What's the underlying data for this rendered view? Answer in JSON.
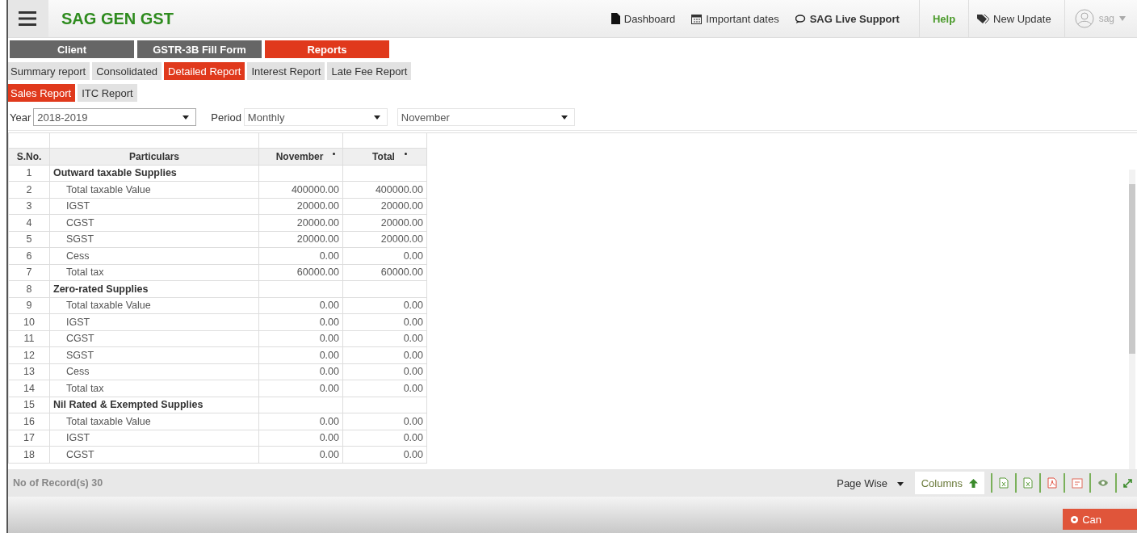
{
  "header": {
    "title": "SAG GEN GST",
    "links": [
      {
        "kind": "file",
        "label": "Dashboard"
      },
      {
        "kind": "calendar",
        "label": "Important dates"
      },
      {
        "kind": "chat",
        "label": "SAG Live Support"
      },
      {
        "kind": "help",
        "label": "Help"
      },
      {
        "kind": "tag",
        "label": "New Update"
      }
    ],
    "user": "sag"
  },
  "main_tabs": [
    {
      "label": "Client",
      "selected": false
    },
    {
      "label": "GSTR-3B Fill Form",
      "selected": false
    },
    {
      "label": "Reports",
      "selected": true
    }
  ],
  "report_tabs": [
    {
      "label": "Summary report",
      "selected": false
    },
    {
      "label": "Consolidated",
      "selected": false
    },
    {
      "label": "Detailed Report",
      "selected": true
    },
    {
      "label": "Interest Report",
      "selected": false
    },
    {
      "label": "Late Fee Report",
      "selected": false
    }
  ],
  "sub_tabs": [
    {
      "label": "Sales Report",
      "selected": true
    },
    {
      "label": "ITC Report",
      "selected": false
    }
  ],
  "filters": {
    "year_label": "Year",
    "year": "2018-2019",
    "period_label": "Period",
    "period": "Monthly",
    "month": "November"
  },
  "table": {
    "columns": [
      "S.No.",
      "Particulars",
      "November",
      "Total"
    ],
    "rows": [
      {
        "sno": "1",
        "particulars": "Outward taxable Supplies",
        "heading": true,
        "november": "",
        "total": ""
      },
      {
        "sno": "2",
        "particulars": "Total taxable Value",
        "heading": false,
        "november": "400000.00",
        "total": "400000.00"
      },
      {
        "sno": "3",
        "particulars": "IGST",
        "heading": false,
        "november": "20000.00",
        "total": "20000.00"
      },
      {
        "sno": "4",
        "particulars": "CGST",
        "heading": false,
        "november": "20000.00",
        "total": "20000.00"
      },
      {
        "sno": "5",
        "particulars": "SGST",
        "heading": false,
        "november": "20000.00",
        "total": "20000.00"
      },
      {
        "sno": "6",
        "particulars": "Cess",
        "heading": false,
        "november": "0.00",
        "total": "0.00"
      },
      {
        "sno": "7",
        "particulars": "Total tax",
        "heading": false,
        "november": "60000.00",
        "total": "60000.00"
      },
      {
        "sno": "8",
        "particulars": "Zero-rated Supplies",
        "heading": true,
        "november": "",
        "total": ""
      },
      {
        "sno": "9",
        "particulars": "Total taxable Value",
        "heading": false,
        "november": "0.00",
        "total": "0.00"
      },
      {
        "sno": "10",
        "particulars": "IGST",
        "heading": false,
        "november": "0.00",
        "total": "0.00"
      },
      {
        "sno": "11",
        "particulars": "CGST",
        "heading": false,
        "november": "0.00",
        "total": "0.00"
      },
      {
        "sno": "12",
        "particulars": "SGST",
        "heading": false,
        "november": "0.00",
        "total": "0.00"
      },
      {
        "sno": "13",
        "particulars": "Cess",
        "heading": false,
        "november": "0.00",
        "total": "0.00"
      },
      {
        "sno": "14",
        "particulars": "Total tax",
        "heading": false,
        "november": "0.00",
        "total": "0.00"
      },
      {
        "sno": "15",
        "particulars": "Nil Rated & Exempted Supplies",
        "heading": true,
        "november": "",
        "total": ""
      },
      {
        "sno": "16",
        "particulars": "Total taxable Value",
        "heading": false,
        "november": "0.00",
        "total": "0.00"
      },
      {
        "sno": "17",
        "particulars": "IGST",
        "heading": false,
        "november": "0.00",
        "total": "0.00"
      },
      {
        "sno": "18",
        "particulars": "CGST",
        "heading": false,
        "november": "0.00",
        "total": "0.00"
      }
    ]
  },
  "footer": {
    "records": "No of Record(s) 30",
    "page_mode": "Page Wise",
    "columns": "Columns"
  },
  "cancel": "Can"
}
